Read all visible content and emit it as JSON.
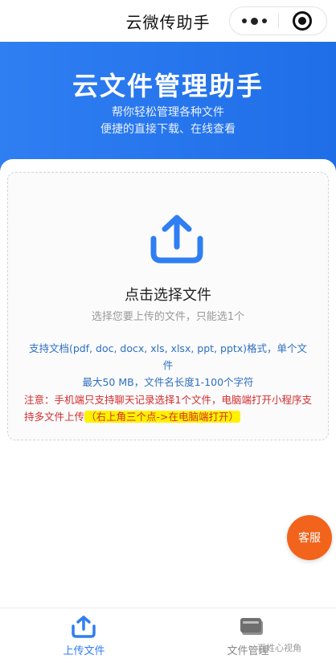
{
  "navbar": {
    "title": "云微传助手"
  },
  "hero": {
    "title": "云文件管理助手",
    "subtitle_line1": "帮你轻松管理各种文件",
    "subtitle_line2": "便捷的直接下载、在线查看"
  },
  "upload": {
    "icon": "upload-icon",
    "title": "点击选择文件",
    "hint": "选择您要上传的文件，只能选1个",
    "formats_line1": "支持文档(pdf, doc, docx, xls, xlsx, ppt, pptx)格式，单个文件",
    "formats_line2": "最大50 MB，文件名长度1-100个字符",
    "notice_text": "注意：手机端只支持聊天记录选择1个文件，电脑端打开小程序支持多文件上传",
    "notice_highlight": "（右上角三个点->在电脑端打开）"
  },
  "service_button": {
    "label": "客服"
  },
  "tabbar": {
    "items": [
      {
        "label": "上传文件",
        "icon": "upload-tab-icon",
        "active": true
      },
      {
        "label": "文件管理",
        "icon": "folder-icon",
        "active": false
      }
    ]
  },
  "watermark": {
    "text": "百姓心视角"
  },
  "colors": {
    "primary": "#2f7ef2",
    "notice": "#d42d2d",
    "highlight": "#fff200",
    "service": "#f2641c"
  }
}
